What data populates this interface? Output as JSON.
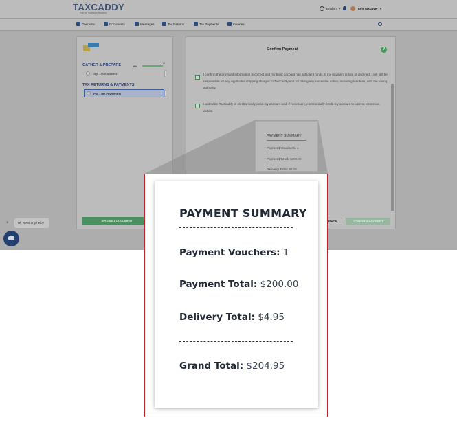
{
  "brand": {
    "name": "TAXCADDY",
    "tagline": "Part of Thomson Reuters"
  },
  "header": {
    "language": "English",
    "user_name": "Tom Taxpayer"
  },
  "nav": {
    "items": [
      {
        "label": "Overview"
      },
      {
        "label": "Documents"
      },
      {
        "label": "Messages"
      },
      {
        "label": "Tax Returns"
      },
      {
        "label": "Tax Payments"
      },
      {
        "label": "Invoices"
      }
    ]
  },
  "sidebar": {
    "gather_heading": "GATHER & PREPARE",
    "gather_progress": "0%",
    "gather_items": [
      {
        "label": "Sign - KBA answers"
      }
    ],
    "returns_heading": "TAX RETURNS & PAYMENTS",
    "returns_items": [
      {
        "label": "Pay - Tax Payment(s)"
      }
    ],
    "upload_label": "UPLOAD A DOCUMENT"
  },
  "main": {
    "title": "Confirm Payment",
    "help": "?",
    "authorization_1": "I confirm the provided information is correct and my bank account has sufficient funds. If my payment is late or declined, I will still be responsible for any applicable shipping charges to TaxCaddy and for taking any corrective action, including late fees, with the taxing authority.",
    "authorization_2": "I authorize TaxCaddy to electronically debit my account and, if necessary, electronically credit my account to correct erroneous debits.",
    "back_label": "BACK",
    "confirm_label": "CONFIRM PAYMENT"
  },
  "chat": {
    "prompt": "Hi. Need any help?",
    "close": "×"
  },
  "payment_summary": {
    "title": "PAYMENT SUMMARY",
    "vouchers_label": "Payment Vouchers:",
    "vouchers_value": "1",
    "payment_total_label": "Payment Total:",
    "payment_total_value": "$200.00",
    "delivery_total_label": "Delivery Total:",
    "delivery_total_value": "$4.95",
    "grand_total_label": "Grand Total:",
    "grand_total_value": "$204.95"
  },
  "icons": [
    "globe-icon",
    "bell-icon",
    "avatar",
    "home-icon",
    "documents-icon",
    "messages-icon",
    "tax-returns-icon",
    "tax-payments-icon",
    "invoices-icon",
    "search-icon",
    "help-icon",
    "chat-icon",
    "close-icon",
    "chevron-down-icon"
  ],
  "colors": {
    "brand_navy": "#2b3f72",
    "accent_green": "#4a9060",
    "highlight_red": "#c8202a"
  }
}
